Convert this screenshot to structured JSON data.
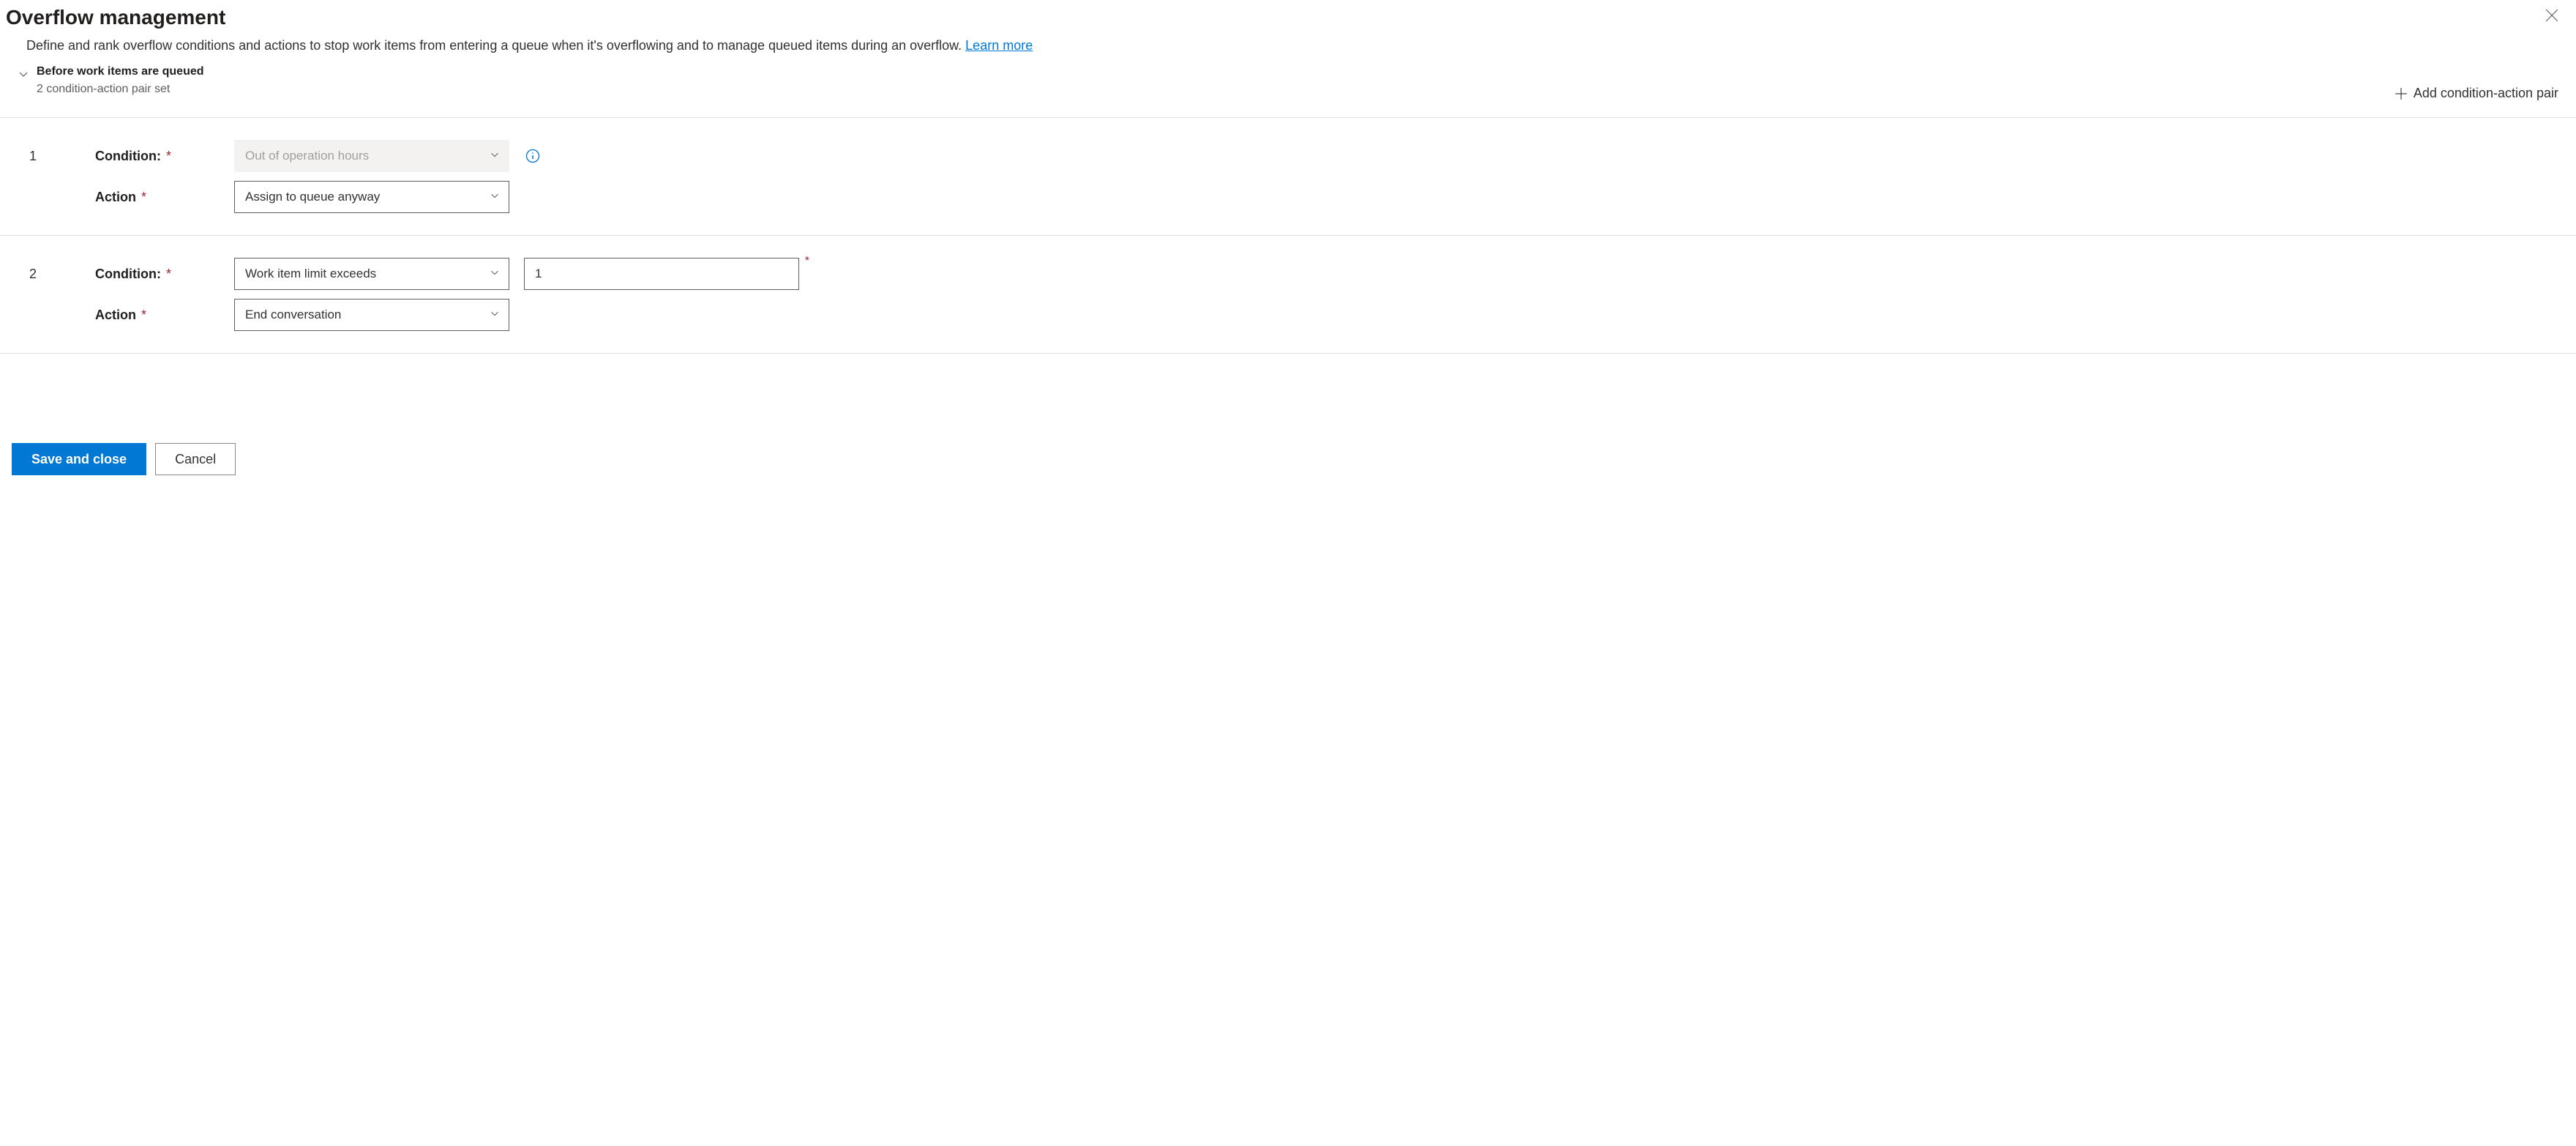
{
  "header": {
    "title": "Overflow management",
    "description_prefix": "Define and rank overflow conditions and actions to stop work items from entering a queue when it's overflowing and to manage queued items during an overflow. ",
    "learn_more": "Learn more"
  },
  "section": {
    "title": "Before work items are queued",
    "subtitle": "2 condition-action pair set",
    "add_button": "Add condition-action pair"
  },
  "labels": {
    "condition": "Condition:",
    "action": "Action"
  },
  "rules": [
    {
      "index": "1",
      "condition_value": "Out of operation hours",
      "condition_disabled": true,
      "action_value": "Assign to queue anyway",
      "has_info": true,
      "has_limit_input": false
    },
    {
      "index": "2",
      "condition_value": "Work item limit exceeds",
      "condition_disabled": false,
      "action_value": "End conversation",
      "has_info": false,
      "has_limit_input": true,
      "limit_value": "1"
    }
  ],
  "footer": {
    "save": "Save and close",
    "cancel": "Cancel"
  }
}
